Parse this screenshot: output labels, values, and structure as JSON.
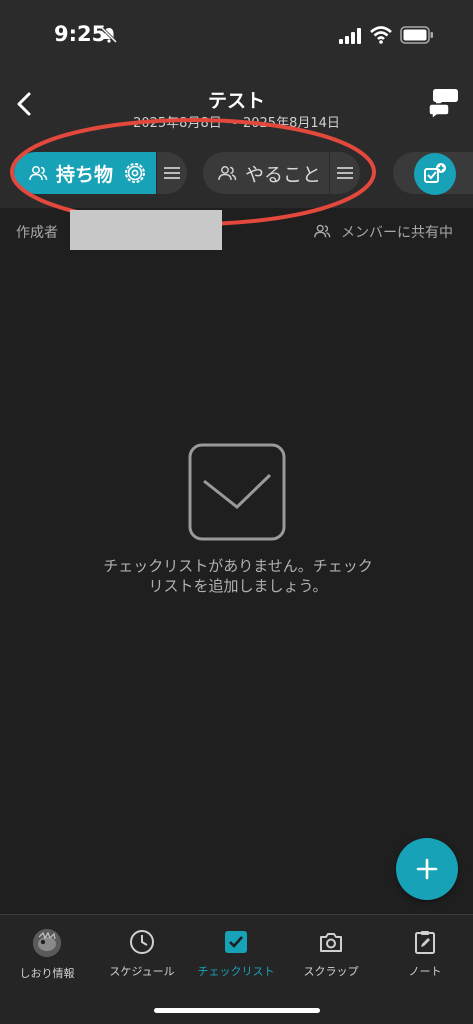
{
  "status_bar": {
    "time": "9:25"
  },
  "nav": {
    "title": "テスト",
    "dates": "2025年8月8日 〜 2025年8月14日"
  },
  "tabs": [
    {
      "label": "持ち物",
      "active": true
    },
    {
      "label": "やること",
      "active": false
    }
  ],
  "meta": {
    "creator_label": "作成者",
    "share_label": "メンバーに共有中"
  },
  "empty_state": {
    "message": "チェックリストがありません。チェックリストを追加しましょう。"
  },
  "bottom_tabs": [
    {
      "label": "しおり情報",
      "icon": "avatar"
    },
    {
      "label": "スケジュール",
      "icon": "clock-icon"
    },
    {
      "label": "チェックリスト",
      "icon": "checkbox-icon",
      "active": true
    },
    {
      "label": "スクラップ",
      "icon": "camera-icon"
    },
    {
      "label": "ノート",
      "icon": "note-icon"
    }
  ],
  "colors": {
    "accent": "#17a2b8",
    "highlight": "#e2483b",
    "background": "#1f1f1f"
  }
}
